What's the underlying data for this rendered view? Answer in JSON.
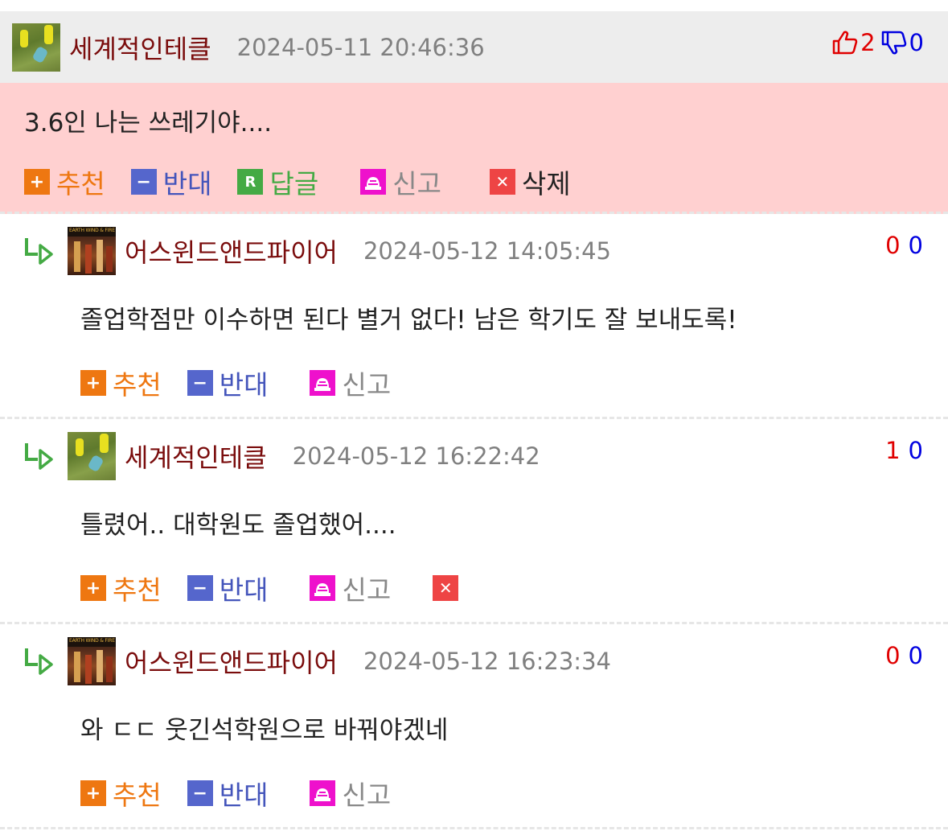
{
  "main_comment": {
    "nickname": "세계적인테클",
    "datetime": "2024-05-11 20:46:36",
    "upvotes": "2",
    "downvotes": "0",
    "text": "3.6인 나는 쓰레기야....",
    "actions": {
      "recommend": "추천",
      "oppose": "반대",
      "reply": "답글",
      "reply_badge": "R",
      "report": "신고",
      "delete": "삭제"
    }
  },
  "replies": [
    {
      "nickname": "어스윈드앤드파이어",
      "datetime": "2024-05-12 14:05:45",
      "upvotes": "0",
      "downvotes": "0",
      "text": "졸업학점만 이수하면 된다 별거 없다! 남은 학기도 잘 보내도록!",
      "recommend": "추천",
      "oppose": "반대",
      "report": "신고"
    },
    {
      "nickname": "세계적인테클",
      "datetime": "2024-05-12 16:22:42",
      "upvotes": "1",
      "downvotes": "0",
      "text": "틀렸어.. 대학원도 졸업했어....",
      "recommend": "추천",
      "oppose": "반대",
      "report": "신고"
    },
    {
      "nickname": "어스윈드앤드파이어",
      "datetime": "2024-05-12 16:23:34",
      "upvotes": "0",
      "downvotes": "0",
      "text": "와 ㄷㄷ 웃긴석학원으로 바꿔야겠네",
      "recommend": "추천",
      "oppose": "반대",
      "report": "신고"
    }
  ],
  "colors": {
    "nickname": "#7a0c0c",
    "upvote": "#e00000",
    "downvote": "#0000e0",
    "highlight_bg": "#ffd0d0",
    "header_bg": "#ededed"
  },
  "icons": {
    "thumbs_up": "thumbs-up-icon",
    "thumbs_down": "thumbs-down-icon",
    "reply_arrow": "reply-arrow-icon",
    "plus": "plus-icon",
    "minus": "minus-icon",
    "report": "siren-icon",
    "delete": "x-icon"
  }
}
